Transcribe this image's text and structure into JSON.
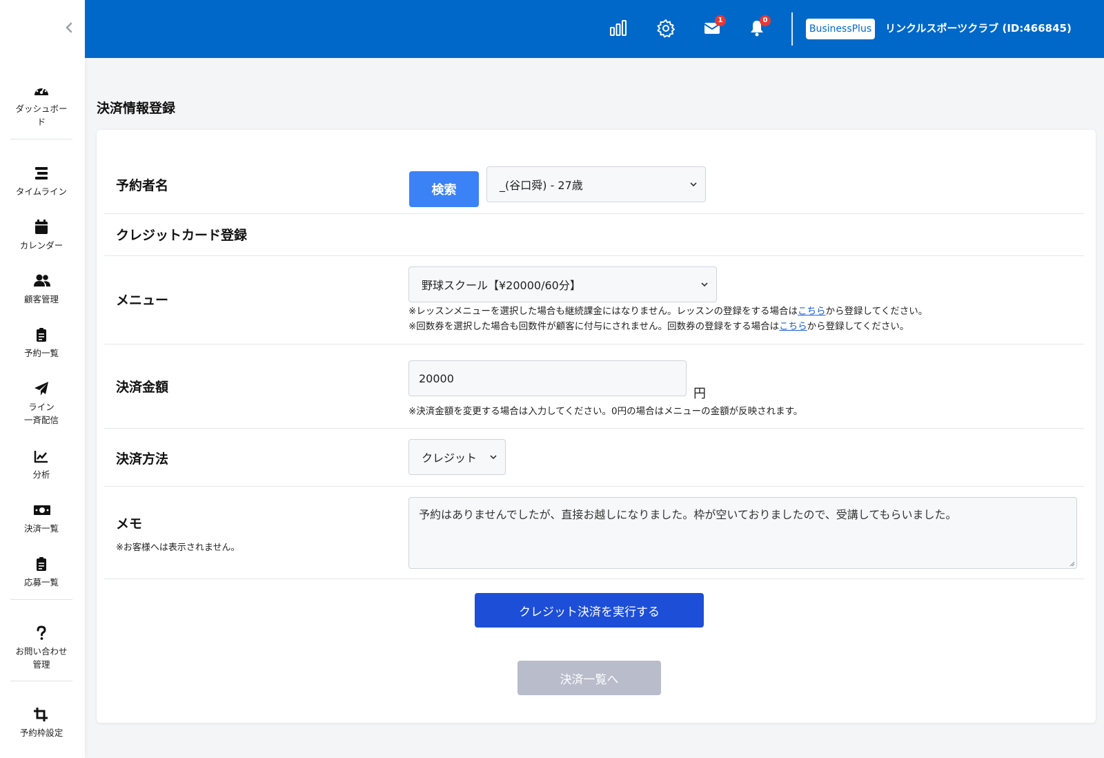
{
  "sidebar": {
    "items": [
      {
        "label": "ダッシュボー\nド",
        "icon": "dashboard-icon"
      },
      {
        "label": "タイムライン",
        "icon": "timeline-icon"
      },
      {
        "label": "カレンダー",
        "icon": "calendar-icon"
      },
      {
        "label": "顧客管理",
        "icon": "users-icon"
      },
      {
        "label": "予約一覧",
        "icon": "clipboard-icon"
      },
      {
        "label": "ライン\n一斉配信",
        "icon": "paper-plane-icon"
      },
      {
        "label": "分析",
        "icon": "chart-line-icon"
      },
      {
        "label": "決済一覧",
        "icon": "money-bill-icon"
      },
      {
        "label": "応募一覧",
        "icon": "clipboard-list-icon"
      },
      {
        "label": "お問い合わせ\n管理",
        "icon": "question-icon"
      },
      {
        "label": "予約枠設定",
        "icon": "crop-icon"
      }
    ]
  },
  "header": {
    "mail_badge": "1",
    "bell_badge": "0",
    "plan_label": "BusinessPlus",
    "club_name": "リンクルスポーツクラブ (ID:466845)",
    "accent": "#0068c9"
  },
  "page": {
    "title": "決済情報登録"
  },
  "form": {
    "reserver_label": "予約者名",
    "search_button": "検索",
    "reserver_value": "_(谷口舜) - 27歳",
    "credit_section": "クレジットカード登録",
    "menu_label": "メニュー",
    "menu_value": "野球スクール【¥20000/60分】",
    "menu_note1_pre": "※レッスンメニューを選択した場合も継続課金にはなりません。レッスンの登録をする場合は",
    "menu_note1_link": "こちら",
    "menu_note1_post": "から登録してください。",
    "menu_note2_pre": "※回数券を選択した場合も回数件が顧客に付与にされません。回数券の登録をする場合は",
    "menu_note2_link": "こちら",
    "menu_note2_post": "から登録してください。",
    "amount_label": "決済金額",
    "amount_value": "20000",
    "amount_unit": "円",
    "amount_note": "※決済金額を変更する場合は入力してください。0円の場合はメニューの金額が反映されます。",
    "method_label": "決済方法",
    "method_value": "クレジット",
    "memo_label": "メモ",
    "memo_sublabel": "※お客様へは表示されません。",
    "memo_value": "予約はありませんでしたが、直接お越しになりました。枠が空いておりましたので、受講してもらいました。",
    "submit_button": "クレジット決済を実行する",
    "back_button": "決済一覧へ"
  }
}
